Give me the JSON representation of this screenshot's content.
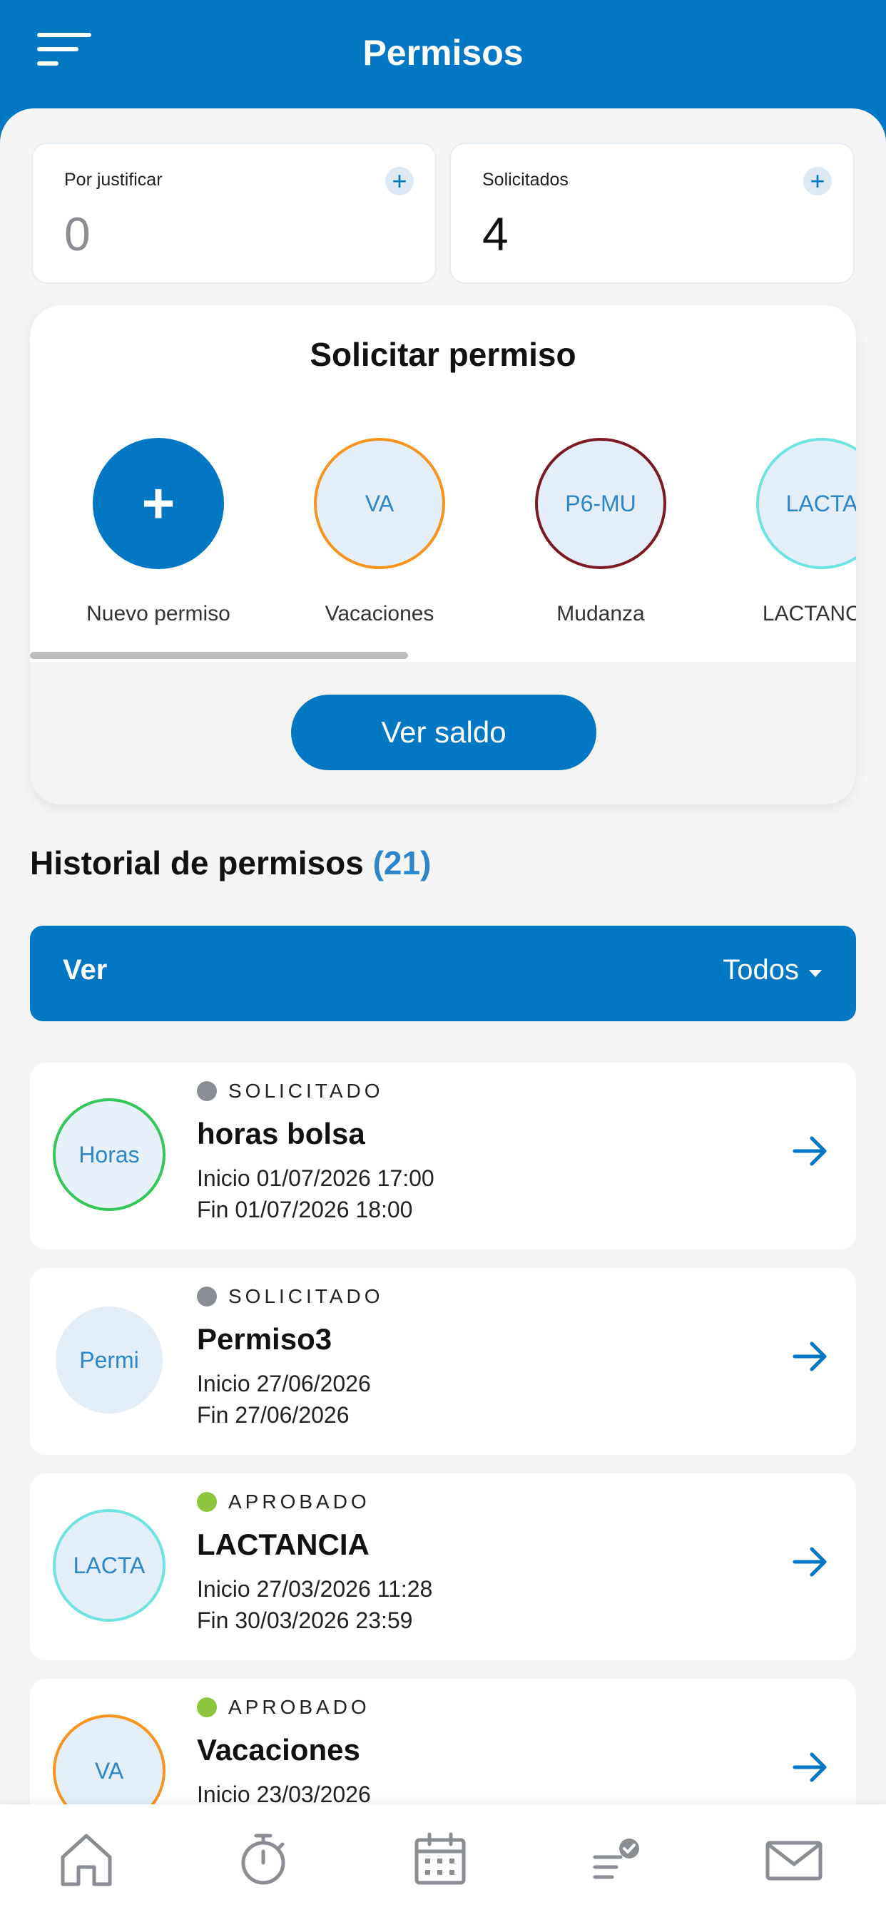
{
  "header": {
    "title": "Permisos"
  },
  "counters": [
    {
      "label": "Por justificar",
      "value": "0"
    },
    {
      "label": "Solicitados",
      "value": "4"
    }
  ],
  "solicitar": {
    "title": "Solicitar permiso",
    "items": [
      {
        "code": "+",
        "label": "Nuevo permiso"
      },
      {
        "code": "VA",
        "label": "Vacaciones"
      },
      {
        "code": "P6-MU",
        "label": "Mudanza"
      },
      {
        "code": "LACTA",
        "label": "LACTANCIA"
      }
    ],
    "button": "Ver saldo"
  },
  "history": {
    "title": "Historial de permisos",
    "count": "(21)",
    "filter_label": "Ver",
    "filter_value": "Todos",
    "items": [
      {
        "avatar": "Horas",
        "status": "SOLICITADO",
        "name": "horas bolsa",
        "start": "Inicio 01/07/2026 17:00",
        "end": "Fin 01/07/2026 18:00"
      },
      {
        "avatar": "Permi",
        "status": "SOLICITADO",
        "name": "Permiso3",
        "start": "Inicio 27/06/2026",
        "end": "Fin 27/06/2026"
      },
      {
        "avatar": "LACTA",
        "status": "APROBADO",
        "name": "LACTANCIA",
        "start": "Inicio 27/03/2026 11:28",
        "end": "Fin 30/03/2026 23:59"
      },
      {
        "avatar": "VA",
        "status": "APROBADO",
        "name": "Vacaciones",
        "start": "Inicio 23/03/2026",
        "end": ""
      }
    ]
  },
  "colors": {
    "primary": "#0277c4",
    "status_solicitado": "#8a8d94",
    "status_aprobado": "#8cc63f",
    "ring_vacaciones": "#f7941d",
    "ring_mudanza": "#7b1a22",
    "ring_lactancia": "#6fe3e0",
    "ring_horas": "#34c759"
  },
  "bottom_nav": {
    "icons": [
      "home-icon",
      "timer-icon",
      "calendar-icon",
      "tasks-check-icon",
      "mail-icon"
    ]
  }
}
